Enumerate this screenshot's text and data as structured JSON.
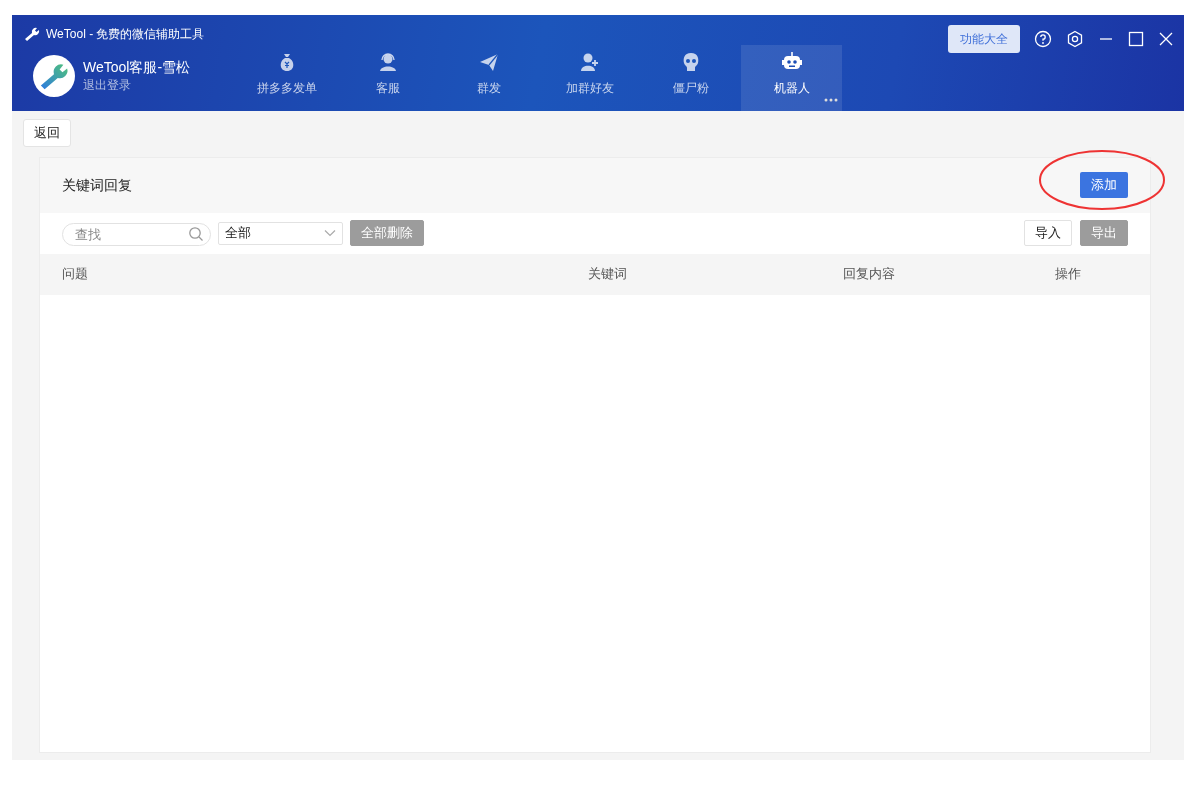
{
  "window": {
    "title": "WeTool - 免费的微信辅助工具",
    "feature_button": "功能大全"
  },
  "account": {
    "name": "WeTool客服-雪松",
    "logout": "退出登录"
  },
  "tabs": [
    {
      "label": "拼多多发单",
      "kind": "bag",
      "selected": false
    },
    {
      "label": "客服",
      "kind": "headset",
      "selected": false
    },
    {
      "label": "群发",
      "kind": "plane",
      "selected": false
    },
    {
      "label": "加群好友",
      "kind": "adduser",
      "selected": false
    },
    {
      "label": "僵尸粉",
      "kind": "skull",
      "selected": false
    },
    {
      "label": "机器人",
      "kind": "robot",
      "selected": true
    }
  ],
  "back_button": "返回",
  "panel": {
    "title": "关键词回复",
    "add_button": "添加",
    "search": {
      "placeholder": "查找"
    },
    "filter": {
      "value": "全部"
    },
    "left_buttons": [
      {
        "label": "全部删除",
        "disabled": true
      }
    ],
    "right_buttons": [
      {
        "label": "导入",
        "disabled": false
      },
      {
        "label": "导出",
        "disabled": true
      }
    ],
    "table": {
      "columns": [
        "问题",
        "关键词",
        "回复内容",
        "操作"
      ]
    }
  }
}
